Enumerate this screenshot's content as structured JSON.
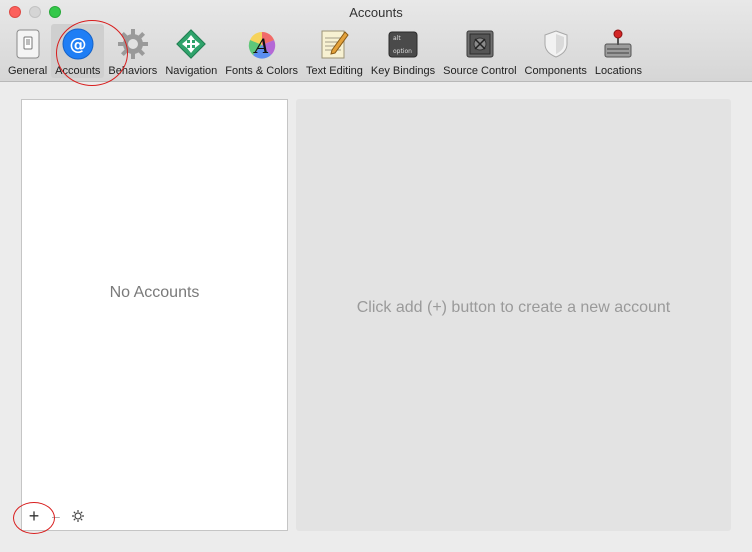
{
  "window": {
    "title": "Accounts"
  },
  "toolbar": {
    "tabs": [
      {
        "label": "General",
        "icon": "switch-icon"
      },
      {
        "label": "Accounts",
        "icon": "at-icon"
      },
      {
        "label": "Behaviors",
        "icon": "gear-icon"
      },
      {
        "label": "Navigation",
        "icon": "navigation-arrows-icon"
      },
      {
        "label": "Fonts & Colors",
        "icon": "font-color-wheel-icon"
      },
      {
        "label": "Text Editing",
        "icon": "notepad-pencil-icon"
      },
      {
        "label": "Key Bindings",
        "icon": "keyboard-key-icon"
      },
      {
        "label": "Source Control",
        "icon": "vault-icon"
      },
      {
        "label": "Components",
        "icon": "shield-icon"
      },
      {
        "label": "Locations",
        "icon": "drive-joystick-icon"
      }
    ],
    "key_labels": {
      "top": "alt",
      "bottom": "option"
    },
    "active_tab": "Accounts"
  },
  "accounts_list": {
    "empty_text": "No Accounts"
  },
  "detail": {
    "empty_text": "Click add (+) button to create a new account"
  },
  "controls": {
    "add": "+",
    "remove": "–"
  },
  "colors": {
    "accent": "#1f7ef5",
    "annotation": "#d81e1e"
  }
}
